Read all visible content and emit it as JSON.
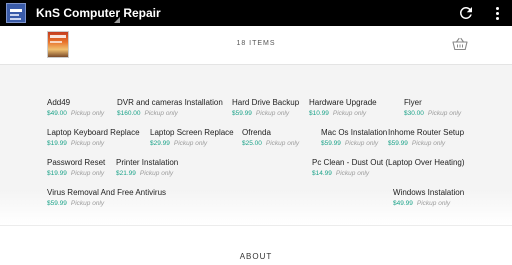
{
  "app": {
    "title": "KnS Computer Repair"
  },
  "cart": {
    "item_count": "18 ITEMS"
  },
  "products": [
    {
      "name": "Add49",
      "price": "$49.00",
      "pickup": "Pickup only"
    },
    {
      "name": "DVR and cameras Installation",
      "price": "$160.00",
      "pickup": "Pickup only"
    },
    {
      "name": "Hard Drive Backup",
      "price": "$59.99",
      "pickup": "Pickup only"
    },
    {
      "name": "Hardware Upgrade",
      "price": "$10.99",
      "pickup": "Pickup only"
    },
    {
      "name": "Flyer",
      "price": "$30.00",
      "pickup": "Pickup only"
    },
    {
      "name": "Laptop Keyboard Replace",
      "price": "$19.99",
      "pickup": "Pickup only"
    },
    {
      "name": "Laptop Screen Replace",
      "price": "$29.99",
      "pickup": "Pickup only"
    },
    {
      "name": "Ofrenda",
      "price": "$25.00",
      "pickup": "Pickup only"
    },
    {
      "name": "Mac Os Instalation",
      "price": "$59.99",
      "pickup": "Pickup only"
    },
    {
      "name": "Inhome Router Setup",
      "price": "$59.99",
      "pickup": "Pickup only"
    },
    {
      "name": "Password Reset",
      "price": "$19.99",
      "pickup": "Pickup only"
    },
    {
      "name": "Printer Instalation",
      "price": "$21.99",
      "pickup": "Pickup only"
    },
    {
      "name": "Pc Clean - Dust Out (Laptop Over Heating)",
      "price": "$14.99",
      "pickup": "Pickup only"
    },
    {
      "name": "Virus Removal And Free Antivirus",
      "price": "$59.99",
      "pickup": "Pickup only"
    },
    {
      "name": "Windows Instalation",
      "price": "$49.99",
      "pickup": "Pickup only"
    }
  ],
  "footer": {
    "about_label": "ABOUT"
  },
  "icons": {
    "refresh": "refresh-icon",
    "overflow": "more-vert-icon",
    "basket": "shopping-basket-icon"
  },
  "colors": {
    "price": "#1ba389",
    "appbar": "#000000"
  }
}
